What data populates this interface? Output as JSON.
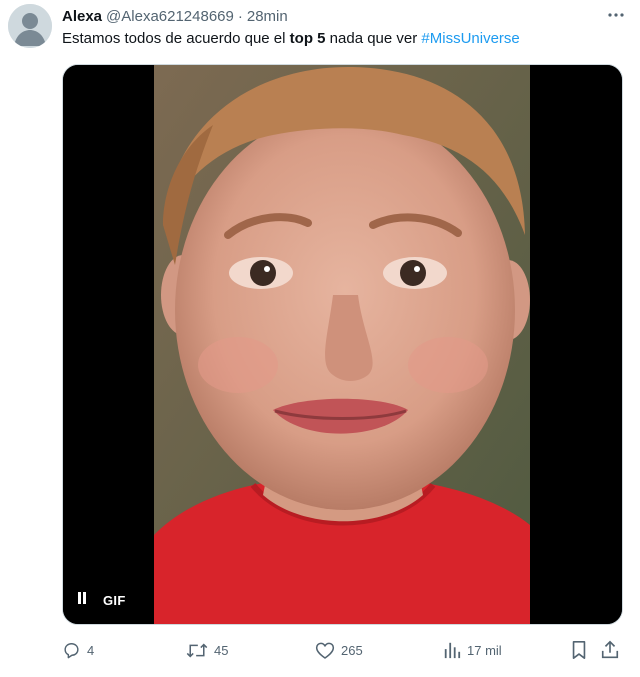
{
  "tweet": {
    "display_name": "Alexa",
    "handle": "@Alexa621248669",
    "separator": "·",
    "time": "28min",
    "text_before": "Estamos todos de acuerdo que el ",
    "text_bold": "top 5",
    "text_after": " nada que ver ",
    "hashtag": "#MissUniverse"
  },
  "media": {
    "badge": "GIF",
    "pause_icon": "pause-icon"
  },
  "actions": {
    "replies": "4",
    "retweets": "45",
    "likes": "265",
    "views": "17 mil"
  },
  "colors": {
    "text": "#0f1419",
    "secondary": "#536471",
    "link": "#1d9bf0",
    "avatar_bg": "#cfd9de"
  },
  "icons": [
    "more-icon",
    "reply-icon",
    "retweet-icon",
    "like-icon",
    "views-icon",
    "bookmark-icon",
    "share-icon"
  ]
}
